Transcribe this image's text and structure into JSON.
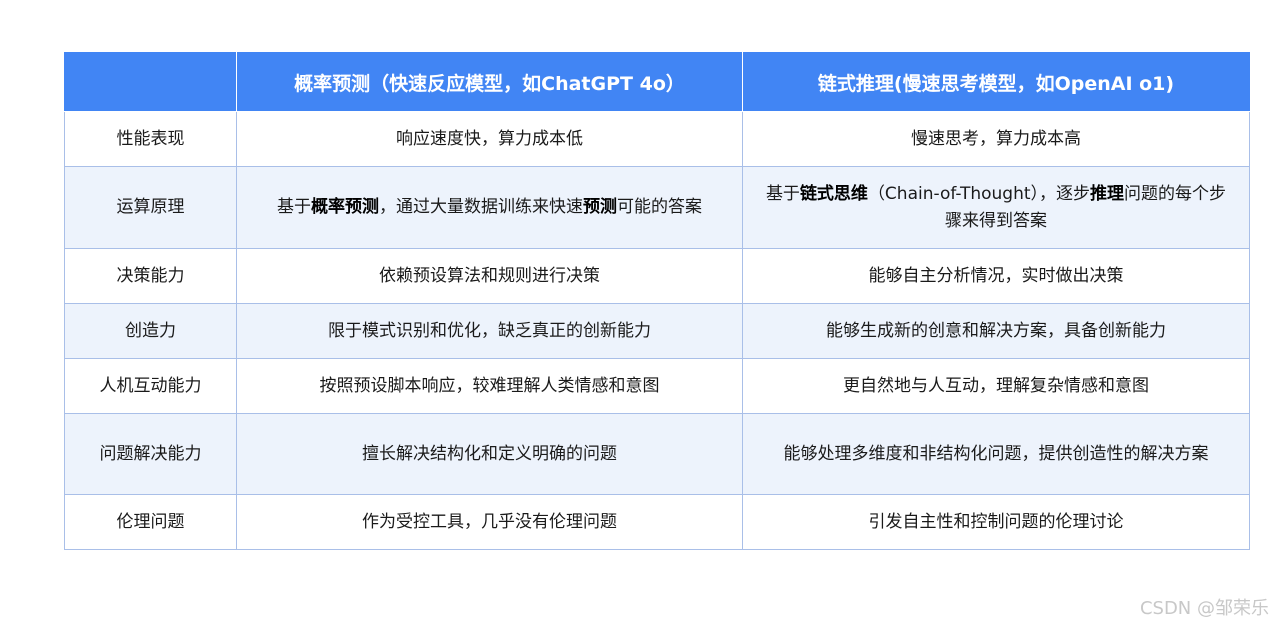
{
  "table": {
    "headers": [
      "",
      "概率预测（快速反应模型，如ChatGPT 4o）",
      "链式推理(慢速思考模型，如OpenAI o1)"
    ],
    "rows": [
      {
        "dimension": "性能表现",
        "prob": "响应速度快，算力成本低",
        "chain": "慢速思考，算力成本高"
      },
      {
        "dimension": "运算原理",
        "prob_parts": [
          "基于",
          "概率预测",
          "，通过大量数据训练来快速",
          "预测",
          "可能的答案"
        ],
        "chain_parts": [
          "基于",
          "链式思维",
          "（Chain-of-Thought），逐步",
          "推理",
          "问题的每个步骤来得到答案"
        ]
      },
      {
        "dimension": "决策能力",
        "prob": "依赖预设算法和规则进行决策",
        "chain": "能够自主分析情况，实时做出决策"
      },
      {
        "dimension": "创造力",
        "prob": "限于模式识别和优化，缺乏真正的创新能力",
        "chain": "能够生成新的创意和解决方案，具备创新能力"
      },
      {
        "dimension": "人机互动能力",
        "prob": "按照预设脚本响应，较难理解人类情感和意图",
        "chain": "更自然地与人互动，理解复杂情感和意图"
      },
      {
        "dimension": "问题解决能力",
        "prob": "擅长解决结构化和定义明确的问题",
        "chain": "能够处理多维度和非结构化问题，提供创造性的解决方案"
      },
      {
        "dimension": "伦理问题",
        "prob": "作为受控工具，几乎没有伦理问题",
        "chain": "引发自主性和控制问题的伦理讨论"
      }
    ]
  },
  "watermark": "CSDN @邹荣乐",
  "colors": {
    "header_bg": "#4185f4",
    "stripe": "#edf3fc",
    "border": "#a9bfe8"
  }
}
